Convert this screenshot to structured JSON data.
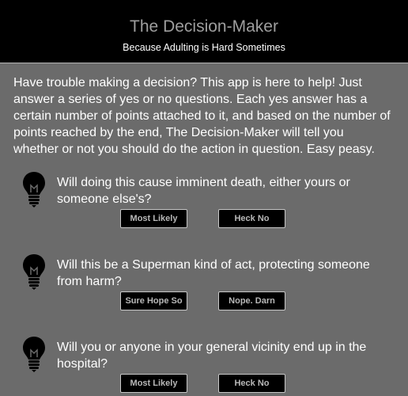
{
  "header": {
    "title": "The Decision-Maker",
    "subtitle": "Because Adulting is Hard Sometimes"
  },
  "intro": "Have trouble making a decision? This app is here to help! Just answer a series of yes or no questions. Each yes answer has a certain number of points attached to it, and based on the number of points reached by the end, The Decision-Maker will tell you whether or not you should do the action in question. Easy peasy.",
  "questions": [
    {
      "text": "Will doing this cause imminent death, either yours or someone else's?",
      "icon": "lightbulb-icon",
      "yes_label": "Most Likely",
      "no_label": "Heck No"
    },
    {
      "text": "Will this be a Superman kind of act, protecting someone from harm?",
      "icon": "lightbulb-icon",
      "yes_label": "Sure Hope So",
      "no_label": "Nope. Darn"
    },
    {
      "text": "Will you or anyone in your general vicinity end up in the hospital?",
      "icon": "lightbulb-icon",
      "yes_label": "Most Likely",
      "no_label": "Heck No"
    }
  ],
  "colors": {
    "background": "#6b6b6b",
    "header_bg": "#000000",
    "title_text": "#9e9e9e",
    "button_bg": "#000000",
    "button_text": "#b8b8b8"
  }
}
